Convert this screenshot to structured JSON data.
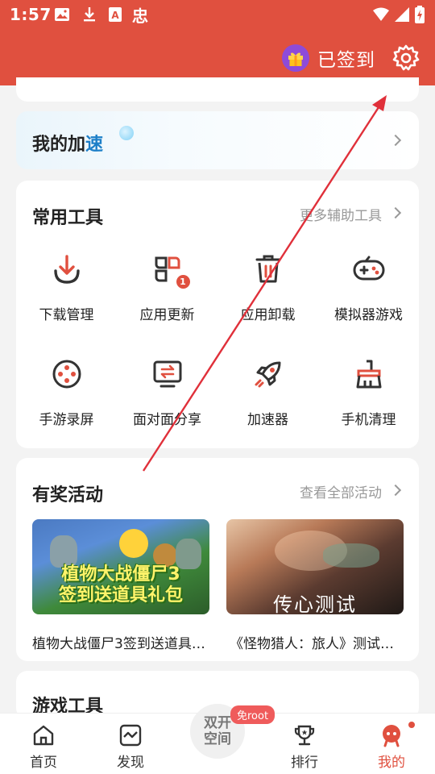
{
  "status_bar": {
    "time": "1:57",
    "app_char": "忠"
  },
  "header": {
    "signin_label": "已签到"
  },
  "accel": {
    "title_part1": "我的加",
    "title_part2": "速"
  },
  "tools": {
    "title": "常用工具",
    "more": "更多辅助工具",
    "items": [
      {
        "label": "下载管理",
        "icon": "download-icon"
      },
      {
        "label": "应用更新",
        "icon": "app-update-icon",
        "badge": "1"
      },
      {
        "label": "应用卸载",
        "icon": "trash-icon"
      },
      {
        "label": "模拟器游戏",
        "icon": "gamepad-icon"
      },
      {
        "label": "手游录屏",
        "icon": "film-reel-icon"
      },
      {
        "label": "面对面分享",
        "icon": "screen-share-icon"
      },
      {
        "label": "加速器",
        "icon": "rocket-icon"
      },
      {
        "label": "手机清理",
        "icon": "broom-icon"
      }
    ]
  },
  "events": {
    "title": "有奖活动",
    "more": "查看全部活动",
    "items": [
      {
        "caption": "植物大战僵尸3签到送道具…",
        "banner_line1": "植物大战僵尸3",
        "banner_line2": "签到送道具礼包"
      },
      {
        "caption": "《怪物猎人：旅人》测试…",
        "banner_text": "传心测试"
      }
    ]
  },
  "games": {
    "title": "游戏工具"
  },
  "bottom_nav": {
    "items": [
      {
        "label": "首页",
        "icon": "home-icon"
      },
      {
        "label": "发现",
        "icon": "discover-icon"
      },
      {
        "label": "排行",
        "icon": "trophy-icon"
      },
      {
        "label": "我的",
        "icon": "profile-icon",
        "active": true
      }
    ],
    "center_line1": "双开",
    "center_line2": "空间",
    "center_badge": "免root"
  },
  "colors": {
    "accent": "#e0503f",
    "gift": "#8e4bd8",
    "link_blue": "#1d7fc8"
  }
}
